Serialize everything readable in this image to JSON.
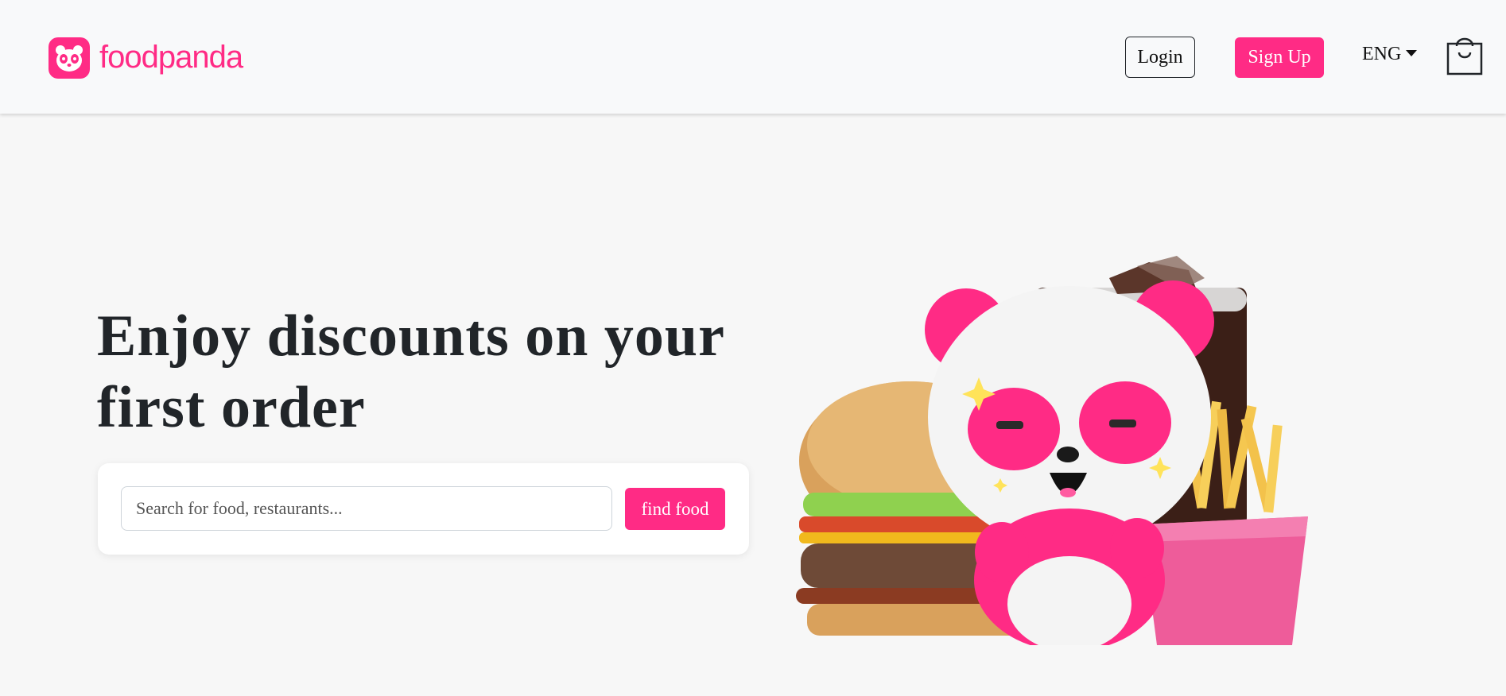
{
  "header": {
    "brand": "foodpanda",
    "login_label": "Login",
    "signup_label": "Sign Up",
    "language": "ENG",
    "cart_icon": "shopping-bag-icon"
  },
  "hero": {
    "title": "Enjoy discounts on your first order",
    "search": {
      "placeholder": "Search for food, restaurants...",
      "value": "",
      "button_label": "find food"
    },
    "illustration": "panda-mascot-with-burger-cola-fries"
  },
  "colors": {
    "brand": "#ff2b85",
    "header_bg": "#f8f9fa",
    "page_bg": "#f7f7f7",
    "text": "#212529"
  }
}
